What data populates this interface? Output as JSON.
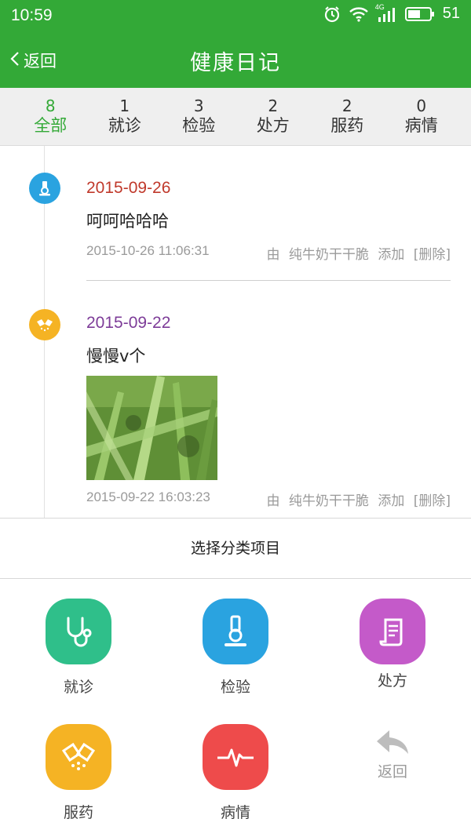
{
  "status_bar": {
    "time": "10:59",
    "network": "4G",
    "battery": "51"
  },
  "header": {
    "back_label": "返回",
    "title": "健康日记"
  },
  "tabs": [
    {
      "count": "8",
      "label": "全部",
      "active": true
    },
    {
      "count": "1",
      "label": "就诊"
    },
    {
      "count": "3",
      "label": "检验"
    },
    {
      "count": "2",
      "label": "处方"
    },
    {
      "count": "2",
      "label": "服药"
    },
    {
      "count": "0",
      "label": "病情"
    }
  ],
  "entries": [
    {
      "icon": "microscope-icon",
      "icon_color": "#2aa3e0",
      "date": "2015-09-26",
      "date_color": "#c0392b",
      "text": "呵呵哈哈哈",
      "timestamp": "2015-10-26 11:06:31",
      "author_prefix": "由",
      "author": "纯牛奶干干脆",
      "action": "添加",
      "delete_label": "[删除]"
    },
    {
      "icon": "pill-icon",
      "icon_color": "#f5b324",
      "date": "2015-09-22",
      "date_color": "#7d3c98",
      "text": "慢慢v个",
      "timestamp": "2015-09-22 16:03:23",
      "author_prefix": "由",
      "author": "纯牛奶干干脆",
      "action": "添加",
      "delete_label": "[删除]"
    }
  ],
  "sheet": {
    "title": "选择分类项目",
    "items": [
      {
        "label": "就诊",
        "icon": "stethoscope-icon",
        "color": "#2fbf8a"
      },
      {
        "label": "检验",
        "icon": "microscope-icon",
        "color": "#2aa3e0"
      },
      {
        "label": "处方",
        "icon": "prescription-icon",
        "color": "#c45ac9"
      },
      {
        "label": "服药",
        "icon": "pill-icon",
        "color": "#f5b324"
      },
      {
        "label": "病情",
        "icon": "heartbeat-icon",
        "color": "#ee4b4b"
      },
      {
        "label": "返回",
        "icon": "reply-arrow-icon",
        "color": "#bdbdbd"
      }
    ]
  }
}
